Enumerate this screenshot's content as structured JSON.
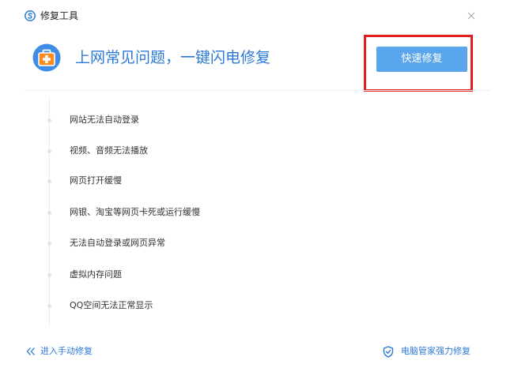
{
  "window": {
    "title": "修复工具",
    "close_symbol": "×"
  },
  "header": {
    "headline": "上网常见问题，一键闪电修复",
    "quick_fix_label": "快速修复",
    "icon": "first-aid-kit-icon"
  },
  "issues": [
    "网站无法自动登录",
    "视频、音频无法播放",
    "网页打开缓慢",
    "网银、淘宝等网页卡死或运行缓慢",
    "无法自动登录或网页异常",
    "虚拟内存问题",
    "QQ空间无法正常显示"
  ],
  "footer": {
    "manual_fix_label": "进入手动修复",
    "pc_manager_label": "电脑管家强力修复"
  },
  "colors": {
    "accent": "#2b7ad6",
    "button": "#5aa6ec",
    "highlight": "#e02020",
    "icon_orange": "#ff8a1f"
  }
}
